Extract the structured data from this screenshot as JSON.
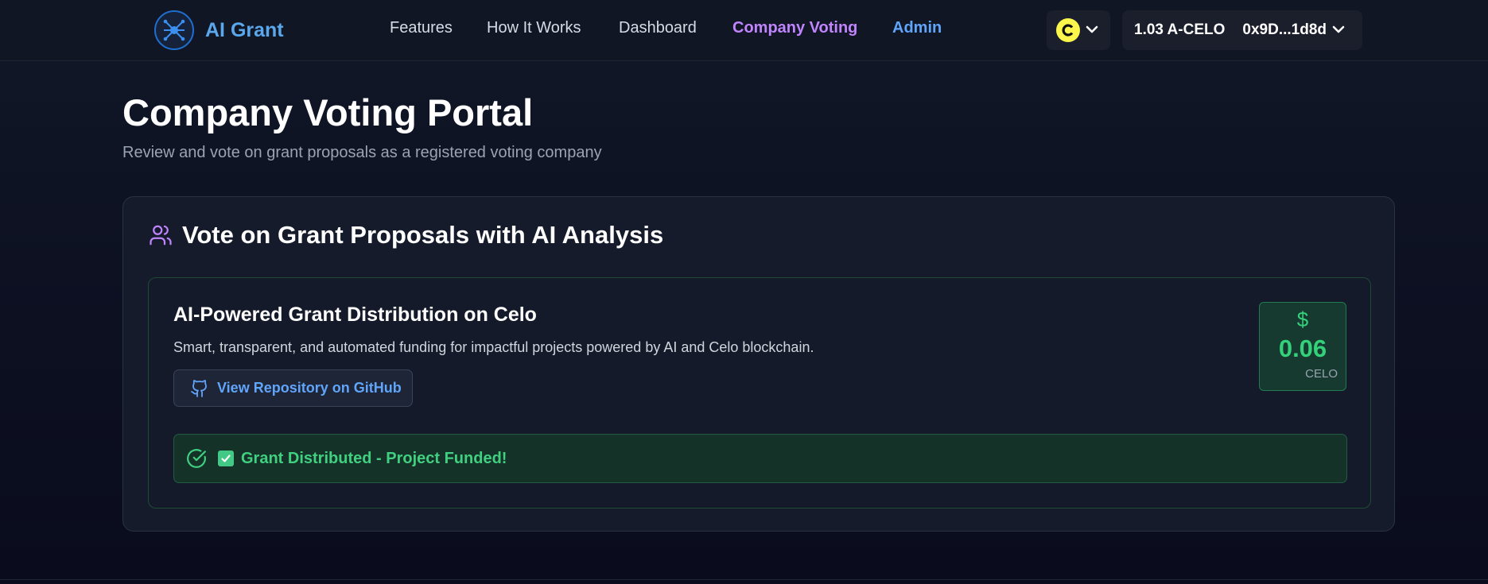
{
  "header": {
    "logo_icon": "network-icon",
    "brand": "AI Grant",
    "nav": {
      "features": "Features",
      "how_it_works": "How It Works",
      "dashboard": "Dashboard",
      "company_voting": "Company Voting",
      "admin": "Admin"
    },
    "chain_icon": "celo-coin-icon",
    "chain_chevron": "❯",
    "account": {
      "balance": "1.03 A-CELO",
      "address": "0x9D...1d8d",
      "chevron": "❯"
    }
  },
  "page": {
    "title": "Company Voting Portal",
    "subtitle": "Review and vote on grant proposals as a registered voting company"
  },
  "card": {
    "icon": "users-icon",
    "title": "Vote on Grant Proposals with AI Analysis",
    "proposal": {
      "title": "AI-Powered Grant Distribution on Celo",
      "description": "Smart, transparent, and automated funding for impactful projects powered by AI and Celo blockchain.",
      "repo_button": "View Repository on GitHub",
      "amount": {
        "symbol": "$",
        "value": "0.06",
        "unit": "CELO"
      },
      "status": "Grant Distributed - Project Funded!"
    }
  },
  "colors": {
    "accent_purple": "#c084fc",
    "accent_blue": "#60a5fa",
    "success_green": "#40d080",
    "celo_yellow": "#fcf54c"
  }
}
